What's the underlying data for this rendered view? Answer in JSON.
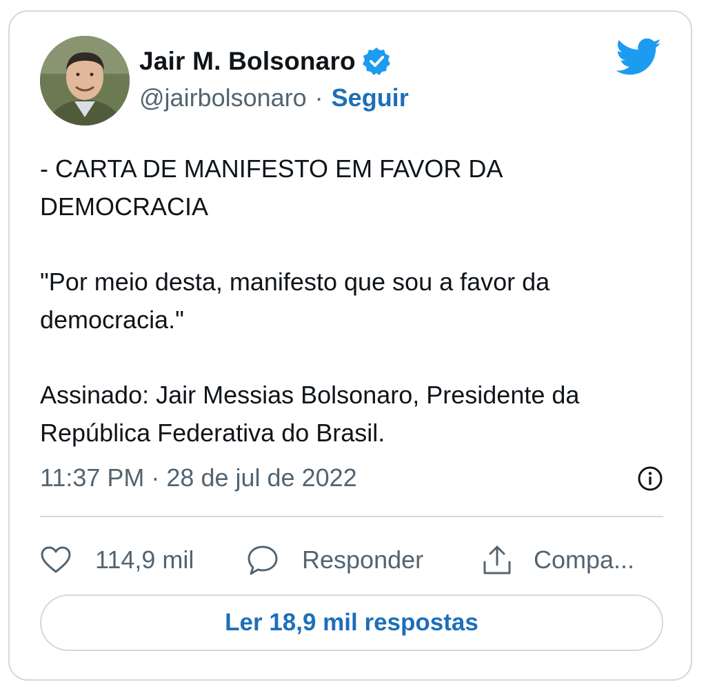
{
  "author": {
    "name": "Jair M. Bolsonaro",
    "handle": "@jairbolsonaro",
    "separator": "·",
    "follow_label": "Seguir",
    "verified": true
  },
  "tweet": {
    "paragraphs": [
      "- CARTA DE MANIFESTO EM FAVOR DA DEMOCRACIA",
      "\"Por meio desta, manifesto que sou a favor da democracia.\"",
      "Assinado: Jair Messias Bolsonaro, Presidente da República Federativa do Brasil."
    ],
    "timestamp": "11:37 PM · 28 de jul de 2022"
  },
  "actions": {
    "likes": "114,9 mil",
    "reply_label": "Responder",
    "share_label": "Compa..."
  },
  "replies_button": "Ler 18,9 mil respostas",
  "icons": {
    "brand": "twitter-bird-icon",
    "verified": "verified-badge-icon",
    "info": "info-icon",
    "like": "heart-icon",
    "reply": "speech-bubble-icon",
    "share": "share-upload-icon"
  },
  "colors": {
    "accent": "#1d6fb8",
    "twitter_blue": "#1d9bf0",
    "text": "#0f1419",
    "secondary": "#536471",
    "border": "#cfd9de"
  }
}
